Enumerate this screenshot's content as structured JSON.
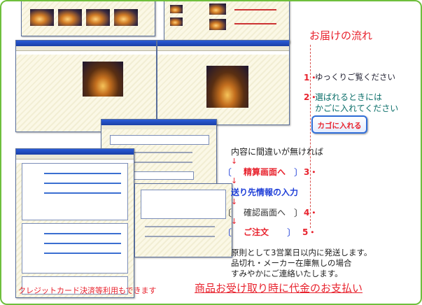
{
  "title": "お届けの流れ",
  "steps": [
    {
      "num": "1・",
      "text": "ゆっくりご覧ください"
    },
    {
      "num": "2・",
      "text": "選ばれるときには"
    },
    {
      "num": "",
      "text": "かごに入れてください"
    }
  ],
  "cart_button_label": "カゴに入れる",
  "flow_intro": "内容に間違いが無ければ",
  "flow": [
    {
      "open": "〔",
      "label": "精算画面へ",
      "close": "〕",
      "num": "3・"
    },
    {
      "label": "送り先情報の入力"
    },
    {
      "open": "〔",
      "label": "確認画面へ",
      "close": "〕",
      "num": "4・"
    },
    {
      "open": "〔",
      "label": "ご注文",
      "close": "〕",
      "num": "5・"
    }
  ],
  "shipping_notes": [
    "原則として3営業日以内に発送します。",
    "品切れ・メーカー在庫無しの場合",
    "すみやかにご連絡いたします。"
  ],
  "credit_note": "クレジットカード決済等利用もできます",
  "cod_note": "商品お受け取り時に代金のお支払い",
  "colors": {
    "accent_red": "#e8232e",
    "blue": "#1f3fd8",
    "teal": "#0b6f6a",
    "border_green": "#6fbf3c"
  }
}
